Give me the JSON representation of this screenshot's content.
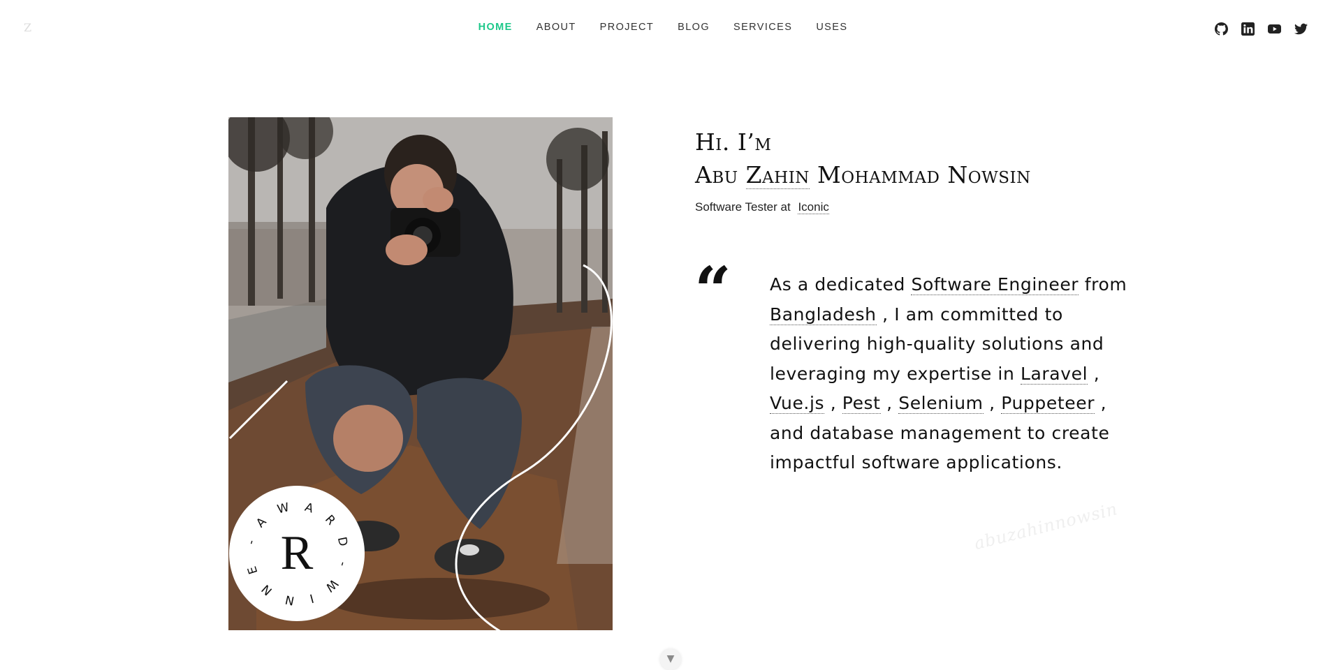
{
  "nav": {
    "logo": "Z",
    "items": [
      {
        "label": "HOME",
        "active": true
      },
      {
        "label": "ABOUT",
        "active": false
      },
      {
        "label": "PROJECT",
        "active": false
      },
      {
        "label": "BLOG",
        "active": false
      },
      {
        "label": "SERVICES",
        "active": false
      },
      {
        "label": "USES",
        "active": false
      }
    ],
    "social": [
      "github-icon",
      "linkedin-icon",
      "youtube-icon",
      "twitter-icon"
    ],
    "accent_color": "#1ec88a"
  },
  "hero": {
    "greeting": "Hi. I’m",
    "name_first": "Abu",
    "name_underlined": "Zahin",
    "name_rest": "Mohammad Nowsin",
    "role_text": "Software Tester at",
    "company": "Iconic",
    "badge": {
      "letter": "R",
      "ring_text": "- A W A R D - W I N N E R"
    },
    "quote_mark": "“",
    "bio": {
      "t1": "As a dedicated ",
      "l1": "Software Engineer",
      "t2": " from ",
      "l2": "Bangladesh",
      "t3": " , I am committed to delivering high-quality solutions and leveraging my expertise in ",
      "l3": "Laravel",
      "t4": " , ",
      "l4": "Vue.js",
      "t5": " , ",
      "l5": "Pest",
      "t6": " , ",
      "l6": "Selenium",
      "t7": " , ",
      "l7": "Puppeteer",
      "t8": " , and database management to create impactful software applications."
    },
    "signature": "abuzahinnowsin",
    "scroll_icon": "chevron-down-icon"
  }
}
